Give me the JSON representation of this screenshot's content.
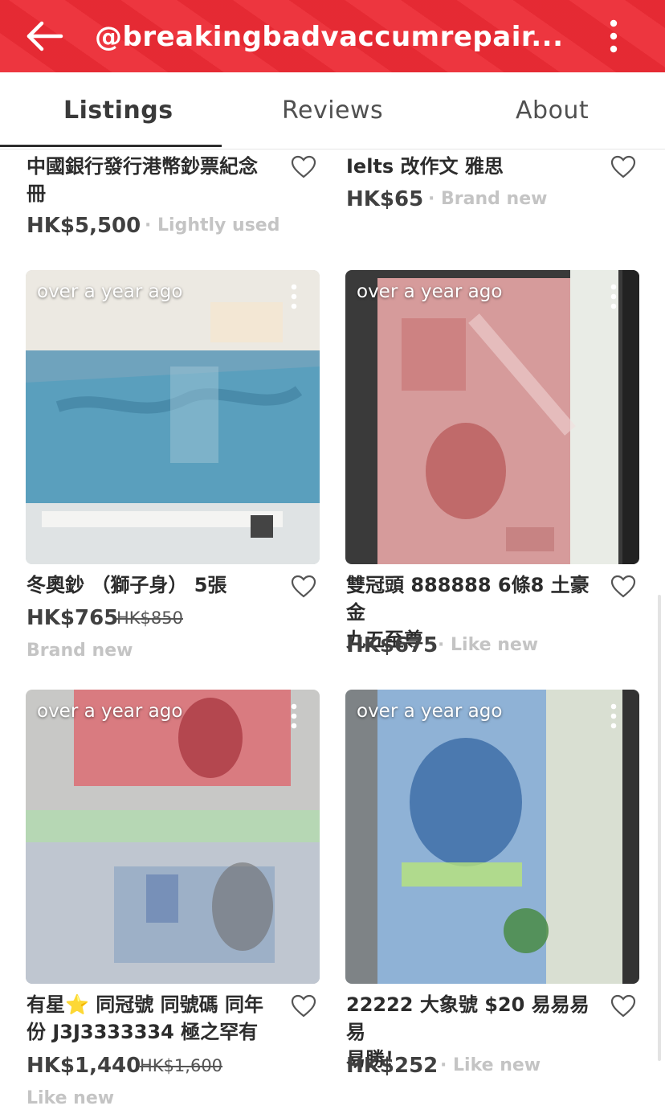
{
  "header": {
    "title": "@breakingbadvaccumrepair...",
    "back_icon": "arrow-left-icon",
    "more_icon": "more-vertical-icon",
    "bg_color": "#ec2b35"
  },
  "tabs": [
    {
      "label": "Listings",
      "active": true
    },
    {
      "label": "Reviews",
      "active": false
    },
    {
      "label": "About",
      "active": false
    }
  ],
  "listings": [
    {
      "title_lines": [
        "中國銀行發行港幣鈔票紀念",
        "冊"
      ],
      "price": "HK$5,500",
      "condition": "· Lightly used"
    },
    {
      "title_lines": [
        "Ielts 改作文 雅思"
      ],
      "price": "HK$65",
      "condition": "· Brand new"
    },
    {
      "time_ago": "over a year ago",
      "title_lines": [
        "冬奧鈔 （獅子身） 5張"
      ],
      "price": "HK$765",
      "old_price": "HK$850",
      "condition": "Brand new"
    },
    {
      "time_ago": "over a year ago",
      "title_lines": [
        "雙冠頭 888888 6條8 土豪金",
        "九五至尊"
      ],
      "price": "HK$675",
      "condition": "· Like new"
    },
    {
      "time_ago": "over a year ago",
      "title_lines": [
        "有星⭐ 同冠號 同號碼 同年",
        "份 J3J3333334 極之罕有"
      ],
      "price": "HK$1,440",
      "old_price": "HK$1,600",
      "condition": "Like new"
    },
    {
      "time_ago": "over a year ago",
      "title_lines": [
        "22222 大象號 $20 易易易易",
        "易勝！"
      ],
      "price": "HK$252",
      "condition": "· Like new"
    }
  ]
}
